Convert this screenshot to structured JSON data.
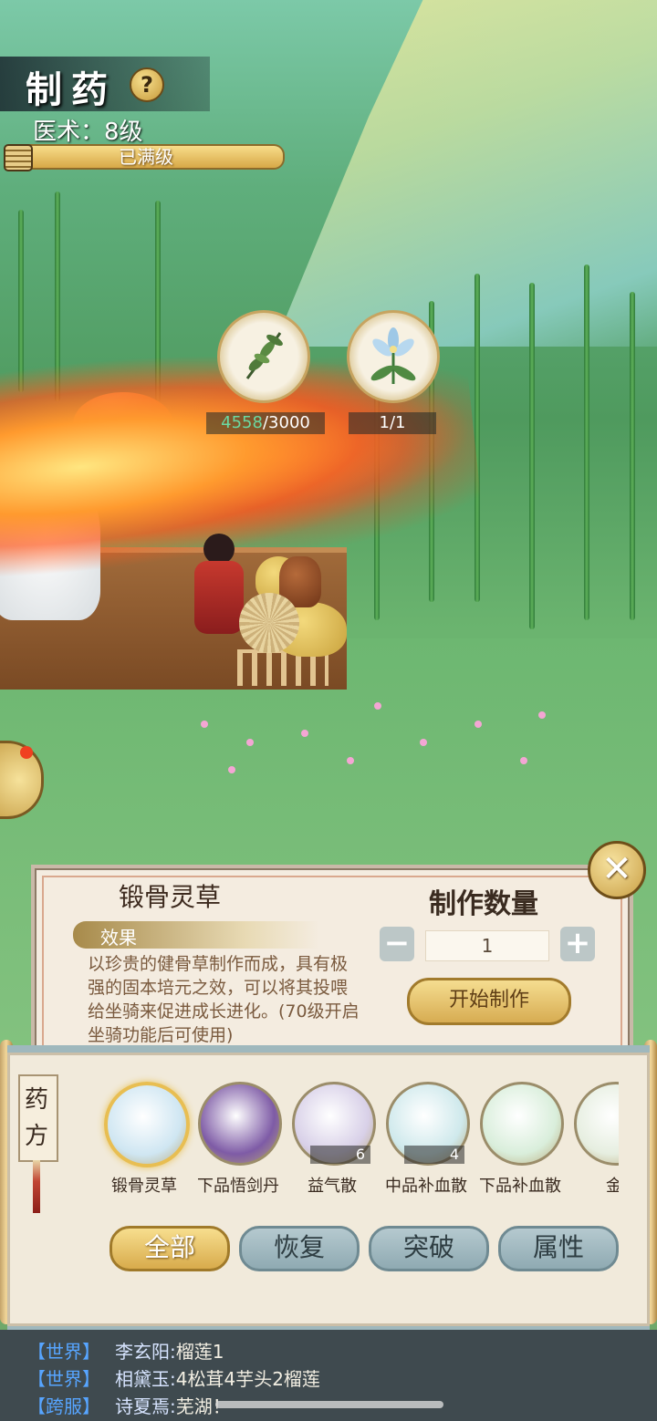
{
  "skill": {
    "title": "制药",
    "help": "?",
    "level_text": "医术：8级",
    "level_status": "已满级",
    "progress_fraction": 1.0
  },
  "ingredients": [
    {
      "icon": "herb-leaf-icon",
      "have": "4558",
      "need": "/3000"
    },
    {
      "icon": "blue-flower-icon",
      "have": "1/1",
      "need": ""
    }
  ],
  "detail": {
    "name": "锻骨灵草",
    "effect_label": "效果",
    "description": "以珍贵的健骨草制作而成，具有极强的固本培元之效，可以将其投喂给坐骑来促进成长进化。(70级开启坐骑功能后可使用)",
    "quantity_title": "制作数量",
    "minus": "−",
    "plus": "+",
    "quantity": "1",
    "start_label": "开始制作",
    "close": "✕"
  },
  "recipe": {
    "tab_label": "药方",
    "items": [
      {
        "name": "锻骨灵草",
        "count": "",
        "color": "#cfe6f2",
        "icon": "blue-flower-icon",
        "selected": true
      },
      {
        "name": "下品悟剑丹",
        "count": "",
        "color": "#7e5ba6",
        "icon": "orb-icon",
        "selected": false
      },
      {
        "name": "益气散",
        "count": "6",
        "color": "#d8d0e8",
        "icon": "vase-icon",
        "selected": false
      },
      {
        "name": "中品补血散",
        "count": "4",
        "color": "#cfe9ec",
        "icon": "powder-icon",
        "selected": false
      },
      {
        "name": "下品补血散",
        "count": "",
        "color": "#d9eedb",
        "icon": "powder-icon",
        "selected": false
      },
      {
        "name": "金",
        "count": "",
        "color": "#e6eee0",
        "icon": "powder-icon",
        "selected": false
      }
    ],
    "filters": [
      "全部",
      "恢复",
      "突破",
      "属性"
    ]
  },
  "chat": [
    {
      "channel": "【世界】",
      "name": "李玄阳:",
      "text": "榴莲1"
    },
    {
      "channel": "【世界】",
      "name": "相黛玉:",
      "text": "4松茸4芋头2榴莲"
    },
    {
      "channel": "【跨服】",
      "name": "诗夏焉:",
      "text": "芜湖！"
    }
  ],
  "colors": {
    "gold": "#d7a847",
    "panel": "#f4ece0",
    "chat_channel": "#57a5ff"
  }
}
